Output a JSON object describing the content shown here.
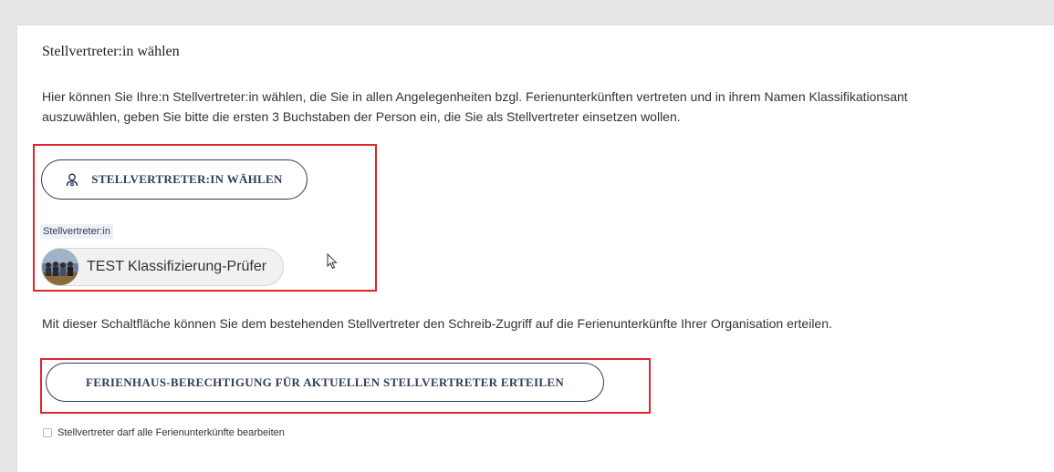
{
  "section": {
    "title": "Stellvertreter:in wählen",
    "intro_line1": "Hier können Sie Ihre:n Stellvertreter:in wählen, die Sie in allen Angelegenheiten bzgl. Ferienunterkünften vertreten und in ihrem Namen Klassifikationsant",
    "intro_line2": "auszuwählen, geben Sie bitte  die ersten 3 Buchstaben der Person ein, die Sie als Stellvertreter einsetzen wollen."
  },
  "select_button": {
    "label": "STELLVERTRETER:IN WÄHLEN",
    "icon": "user-search-icon"
  },
  "current_deputy": {
    "field_label": "Stellvertreter:in",
    "name": "TEST Klassifizierung-Prüfer"
  },
  "permission": {
    "note": "Mit dieser Schaltfläche können Sie dem bestehenden Stellvertreter den Schreib-Zugriff auf die Ferienunterkünfte Ihrer Organisation erteilen.",
    "button_label": "FERIENHAUS-BERECHTIGUNG FÜR AKTUELLEN STELLVERTRETER ERTEILEN",
    "checkbox_label": "Stellvertreter darf alle Ferienunterkünfte bearbeiten",
    "checkbox_checked": false
  },
  "colors": {
    "accent": "#2c3e5c",
    "highlight": "#e0252d",
    "background": "#e6e6e6"
  }
}
